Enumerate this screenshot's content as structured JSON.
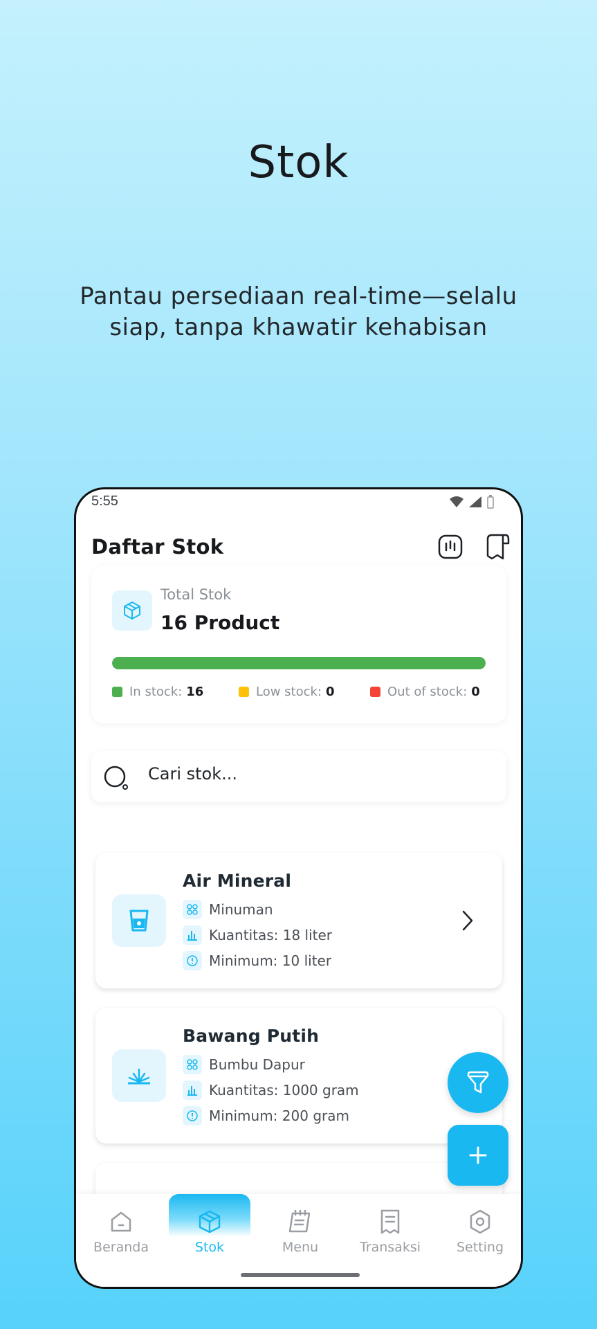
{
  "promo": {
    "title": "Stok",
    "subtitle": "Pantau persediaan real-time—selalu siap, tanpa khawatir kehabisan"
  },
  "status_bar": {
    "time": "5:55",
    "icons": [
      "wifi-icon",
      "signal-icon",
      "battery-icon"
    ]
  },
  "header": {
    "title": "Daftar Stok",
    "actions": [
      "report-icon",
      "receipt-icon"
    ]
  },
  "summary": {
    "label": "Total Stok",
    "value": "16 Product",
    "in_stock_fraction": 1.0,
    "legend": [
      {
        "label": "In stock:",
        "value": "16",
        "color": "#4caf50"
      },
      {
        "label": "Low stock:",
        "value": "0",
        "color": "#ffc107"
      },
      {
        "label": "Out of stock:",
        "value": "0",
        "color": "#f44336"
      }
    ]
  },
  "search": {
    "placeholder": "Cari stok..."
  },
  "items": [
    {
      "name": "Air Mineral",
      "icon": "drink-icon",
      "category": "Minuman",
      "quantity": "Kuantitas: 18 liter",
      "minimum": "Minimum: 10 liter"
    },
    {
      "name": "Bawang Putih",
      "icon": "spice-icon",
      "category": "Bumbu Dapur",
      "quantity": "Kuantitas: 1000 gram",
      "minimum": "Minimum: 200 gram"
    }
  ],
  "fabs": [
    "filter-icon",
    "plus-icon"
  ],
  "nav": [
    {
      "label": "Beranda",
      "icon": "home-icon",
      "active": false
    },
    {
      "label": "Stok",
      "icon": "box-icon",
      "active": true
    },
    {
      "label": "Menu",
      "icon": "menu-book-icon",
      "active": false
    },
    {
      "label": "Transaksi",
      "icon": "receipt-icon",
      "active": false
    },
    {
      "label": "Setting",
      "icon": "gear-icon",
      "active": false
    }
  ],
  "colors": {
    "accent": "#1ab8f0",
    "in_stock": "#4caf50",
    "low_stock": "#ffc107",
    "out_of_stock": "#f44336"
  }
}
